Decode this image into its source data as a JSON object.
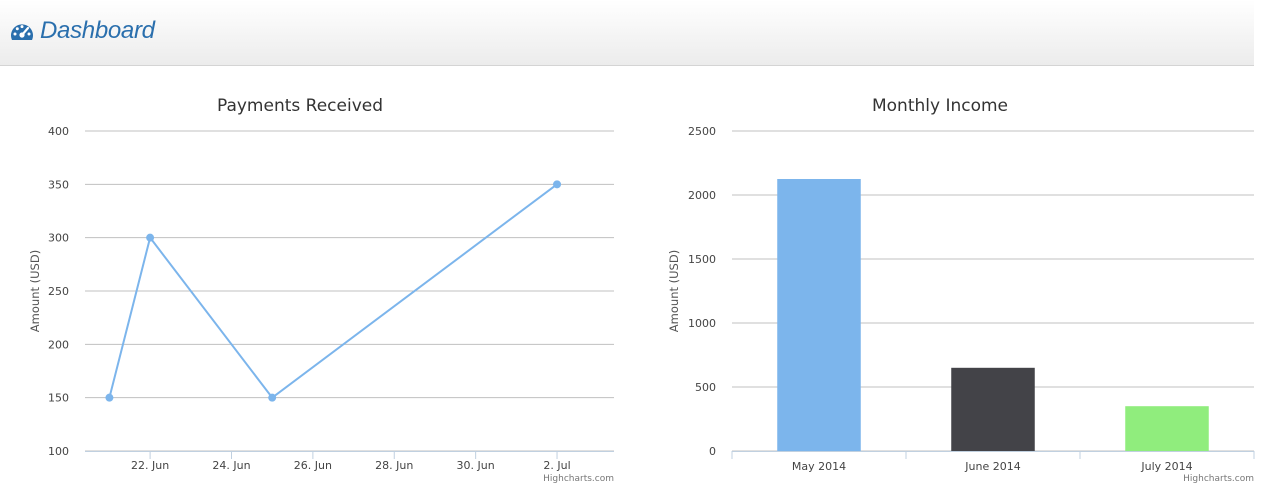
{
  "header": {
    "title": "Dashboard",
    "icon": "dashboard-icon"
  },
  "chart_data": [
    {
      "type": "line",
      "title": "Payments Received",
      "ylabel": "Amount (USD)",
      "xlabel": "",
      "ylim": [
        100,
        400
      ],
      "yticks": [
        100,
        150,
        200,
        250,
        300,
        350,
        400
      ],
      "xlim": [
        "2014-06-20",
        "2014-07-03"
      ],
      "xticks": [
        {
          "date": "2014-06-22",
          "label": "22. Jun"
        },
        {
          "date": "2014-06-24",
          "label": "24. Jun"
        },
        {
          "date": "2014-06-26",
          "label": "26. Jun"
        },
        {
          "date": "2014-06-28",
          "label": "28. Jun"
        },
        {
          "date": "2014-06-30",
          "label": "30. Jun"
        },
        {
          "date": "2014-07-02",
          "label": "2. Jul"
        }
      ],
      "series": [
        {
          "color": "#7cb5ec",
          "points": [
            {
              "x": "2014-06-21",
              "y": 150
            },
            {
              "x": "2014-06-22",
              "y": 300
            },
            {
              "x": "2014-06-25",
              "y": 150
            },
            {
              "x": "2014-07-02",
              "y": 350
            }
          ]
        }
      ],
      "grid": true,
      "credits": "Highcharts.com"
    },
    {
      "type": "bar",
      "title": "Monthly Income",
      "ylabel": "Amount (USD)",
      "xlabel": "",
      "ylim": [
        0,
        2500
      ],
      "yticks": [
        0,
        500,
        1000,
        1500,
        2000,
        2500
      ],
      "categories": [
        "May 2014",
        "June 2014",
        "July 2014"
      ],
      "values": [
        2125,
        650,
        350
      ],
      "colors": [
        "#7cb5ec",
        "#434348",
        "#90ed7d"
      ],
      "grid": true,
      "credits": "Highcharts.com"
    }
  ]
}
